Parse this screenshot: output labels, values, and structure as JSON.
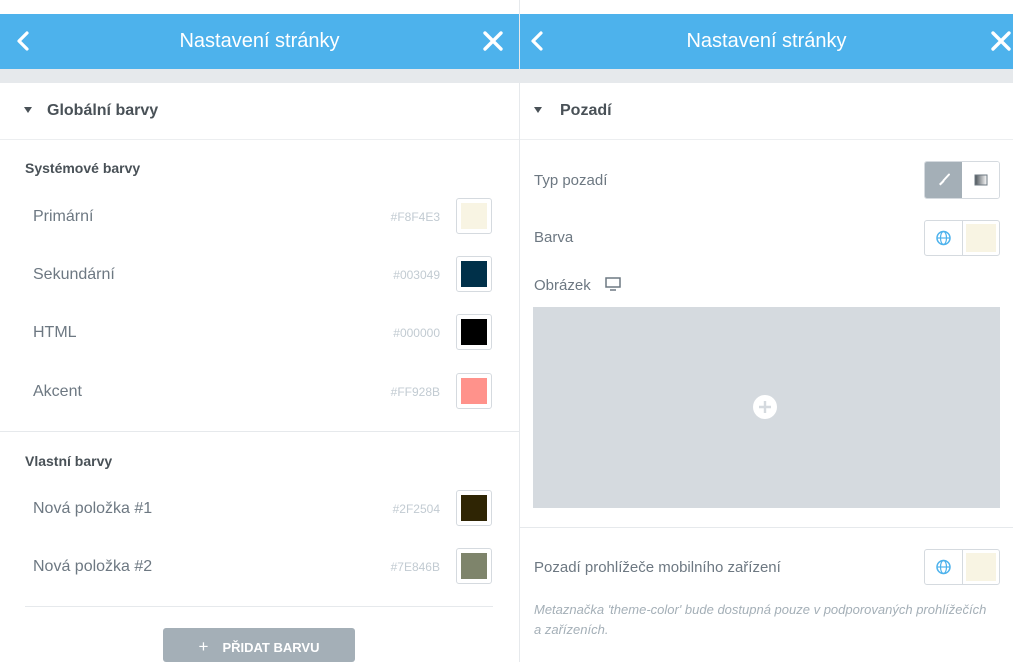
{
  "colors": {
    "accent": "#4db2ec",
    "label": "#6d7882",
    "hex_text": "#c2cbd2",
    "button_grey": "#a4afb7",
    "media_grey": "#d5dadf"
  },
  "left_panel": {
    "header": {
      "title": "Nastavení stránky",
      "back_icon": "chevron-left-icon",
      "close_icon": "close-icon"
    },
    "section_title": "Globální barvy",
    "system": {
      "title": "Systémové barvy",
      "items": [
        {
          "name": "Primární",
          "hex": "#F8F4E3",
          "color": "#F8F4E3"
        },
        {
          "name": "Sekundární",
          "hex": "#003049",
          "color": "#003049"
        },
        {
          "name": "HTML",
          "hex": "#000000",
          "color": "#000000"
        },
        {
          "name": "Akcent",
          "hex": "#FF928B",
          "color": "#FF928B"
        }
      ]
    },
    "custom": {
      "title": "Vlastní barvy",
      "items": [
        {
          "name": "Nová položka #1",
          "hex": "#2F2504",
          "color": "#2F2504"
        },
        {
          "name": "Nová položka #2",
          "hex": "#7E846B",
          "color": "#7E846B"
        }
      ]
    },
    "add_button": {
      "icon": "plus-icon",
      "label": "PŘIDAT BARVU"
    }
  },
  "right_panel": {
    "header": {
      "title": "Nastavení stránky",
      "back_icon": "chevron-left-icon",
      "close_icon": "close-icon"
    },
    "section_title": "Pozadí",
    "background_type": {
      "label": "Typ pozadí",
      "options": [
        "brush-icon",
        "gradient-icon"
      ],
      "selected": "brush-icon"
    },
    "color": {
      "label": "Barva",
      "value": "#F8F4E3",
      "globe_icon": "globe-icon"
    },
    "image": {
      "label": "Obrázek",
      "device_icon": "desktop-icon",
      "add_icon": "plus-circle-icon"
    },
    "mobile_bg": {
      "label": "Pozadí prohlížeče mobilního zařízení",
      "value": "#F8F4E3",
      "globe_icon": "globe-icon"
    },
    "note": "Metaznačka 'theme-color' bude dostupná pouze v podporovaných prohlížečích a zařízeních."
  }
}
